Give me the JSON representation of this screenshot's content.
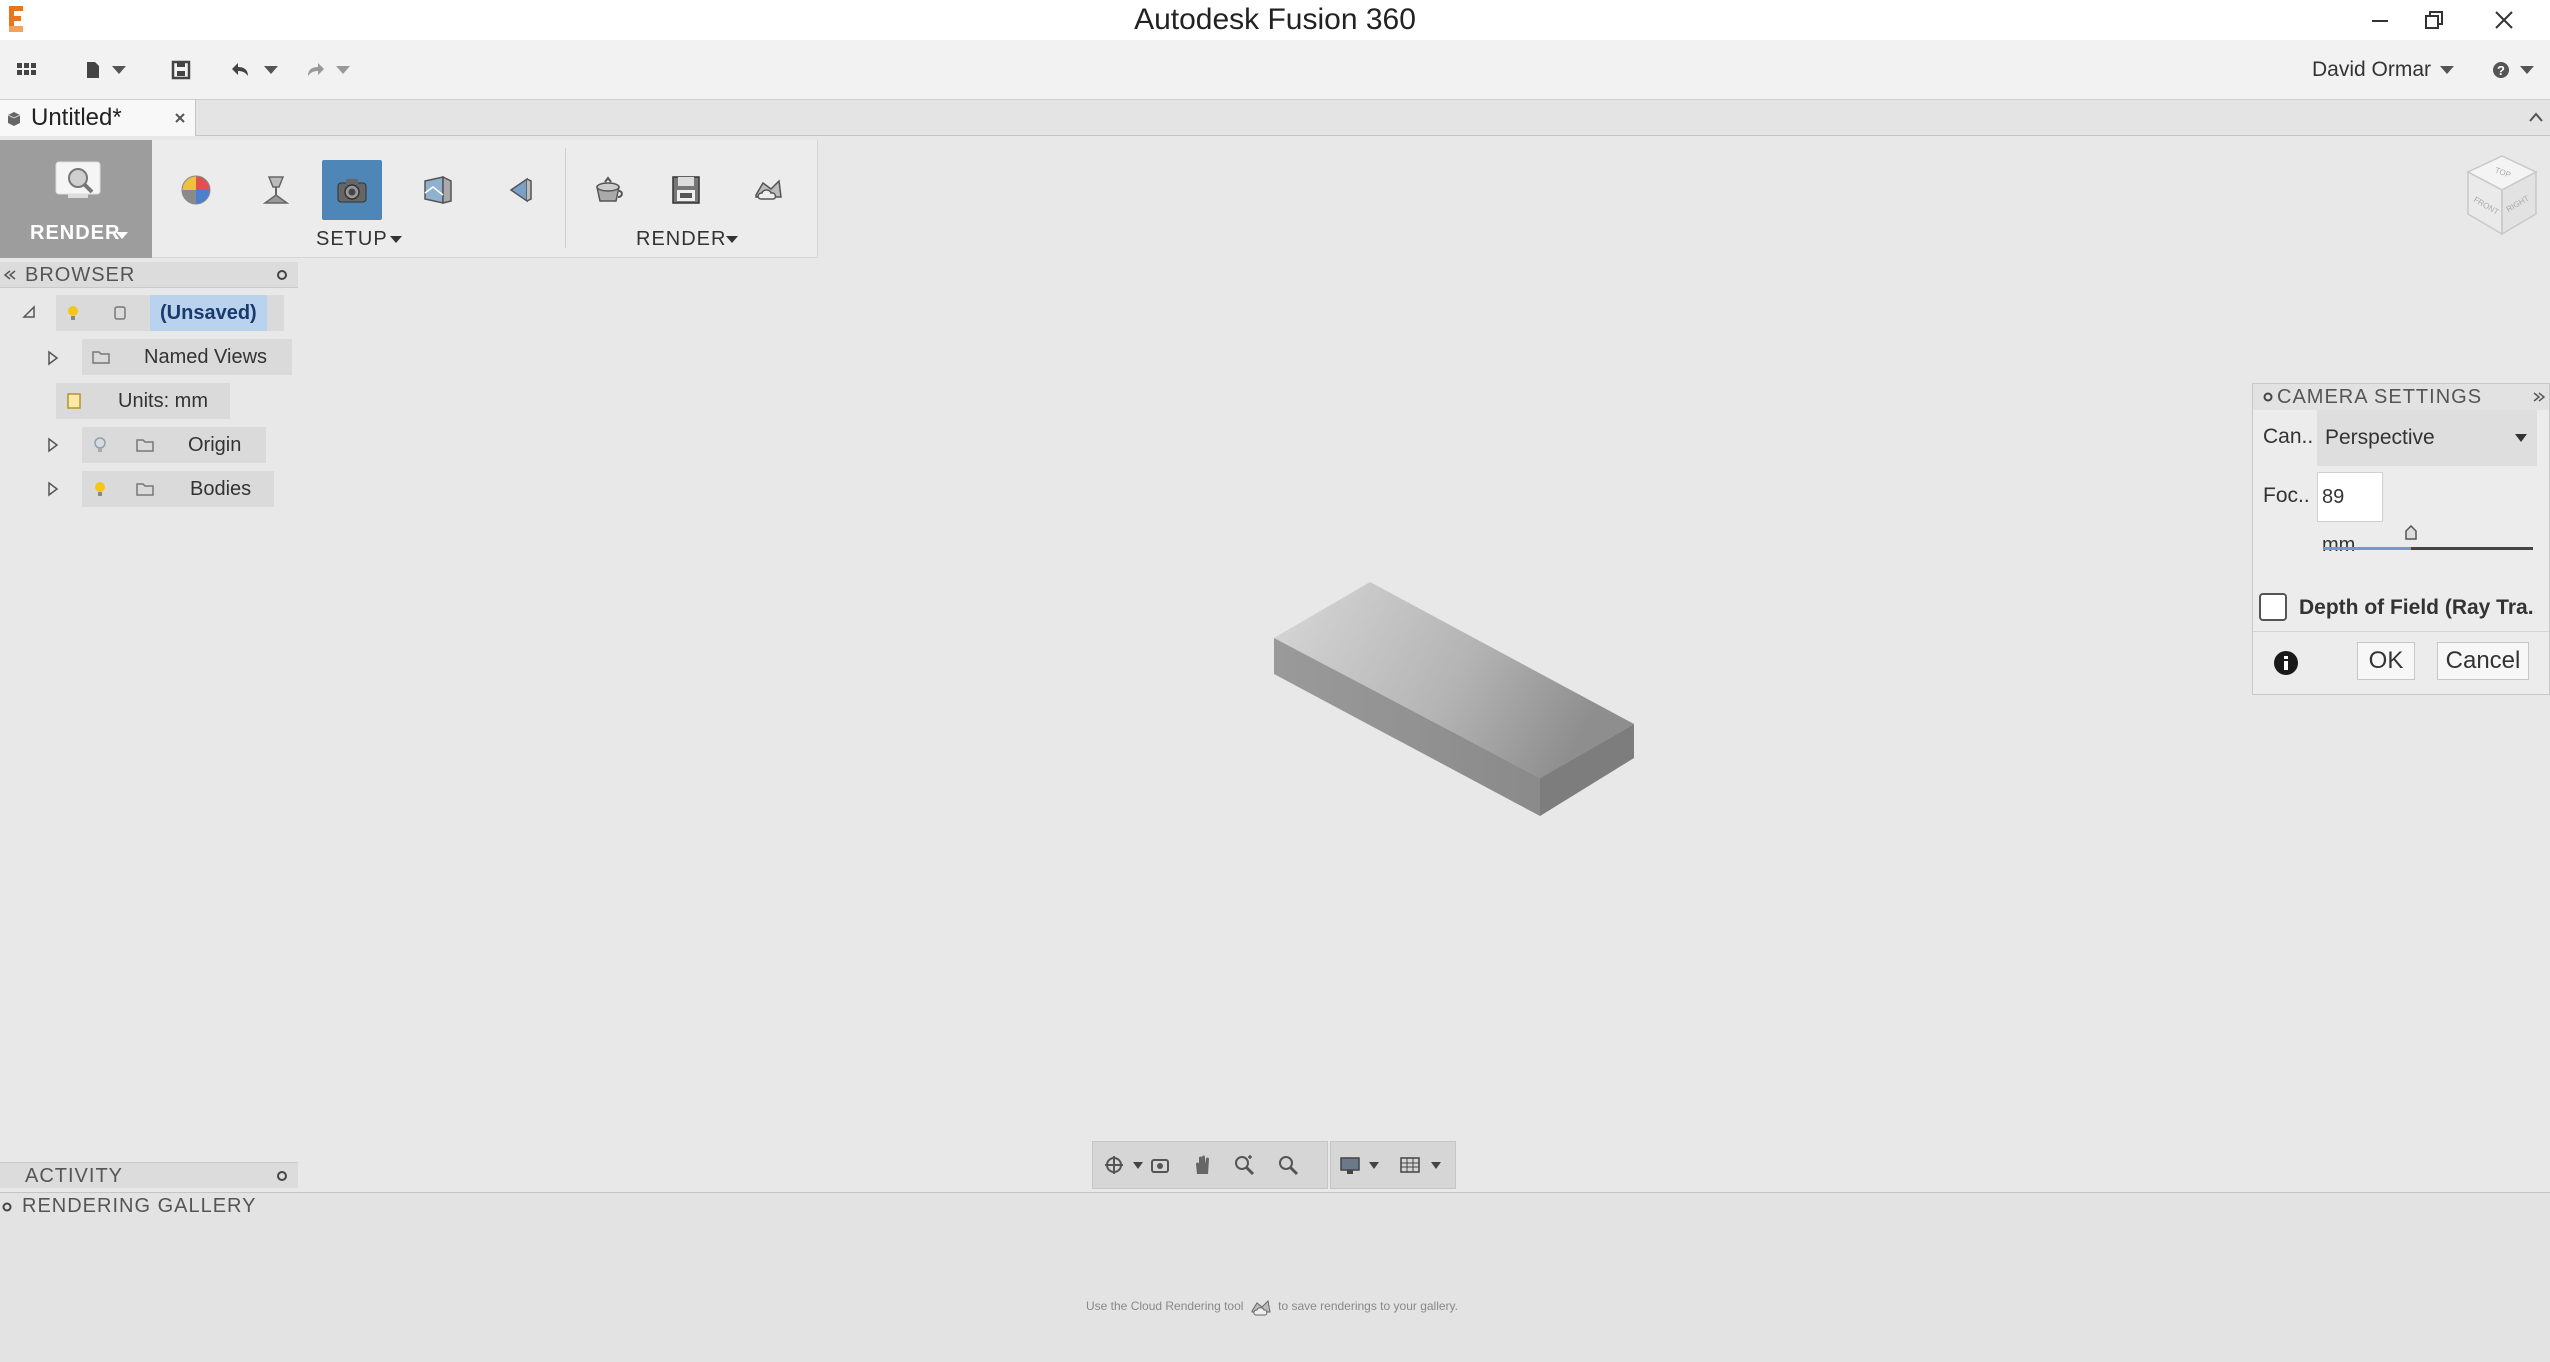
{
  "window": {
    "title": "Autodesk Fusion 360"
  },
  "toolbar": {
    "user_name": "David Ormar"
  },
  "document_tab": {
    "label": "Untitled*"
  },
  "ribbon": {
    "workspace_label": "RENDER",
    "setup_label": "SETUP",
    "render_label": "RENDER",
    "setup_icons": [
      "appearance-icon",
      "scene-settings-icon",
      "camera-icon",
      "environment-icon",
      "decal-icon"
    ],
    "render_icons": [
      "in-canvas-render-icon",
      "render-icon",
      "cloud-render-icon"
    ]
  },
  "browser": {
    "title": "BROWSER",
    "items": [
      {
        "label": "(Unsaved)"
      },
      {
        "label": "Named Views"
      },
      {
        "label": "Units: mm"
      },
      {
        "label": "Origin"
      },
      {
        "label": "Bodies"
      }
    ]
  },
  "camera_settings": {
    "title": "CAMERA SETTINGS",
    "camera_label": "Can..",
    "camera_value": "Perspective",
    "focal_label": "Foc..",
    "focal_value": "89 mm",
    "focal_slider_fraction": 0.42,
    "dof_label": "Depth of Field (Ray Tra..",
    "dof_checked": false,
    "ok_label": "OK",
    "cancel_label": "Cancel"
  },
  "activity": {
    "title": "ACTIVITY"
  },
  "rendering_gallery": {
    "title": "RENDERING GALLERY",
    "hint_before": "Use the Cloud Rendering tool",
    "hint_after": "to save renderings to your gallery."
  },
  "colors": {
    "accent": "#4d86b7",
    "selection": "#b9d3ef",
    "workspace": "#9d9d9d",
    "logo": "#e8761e"
  }
}
